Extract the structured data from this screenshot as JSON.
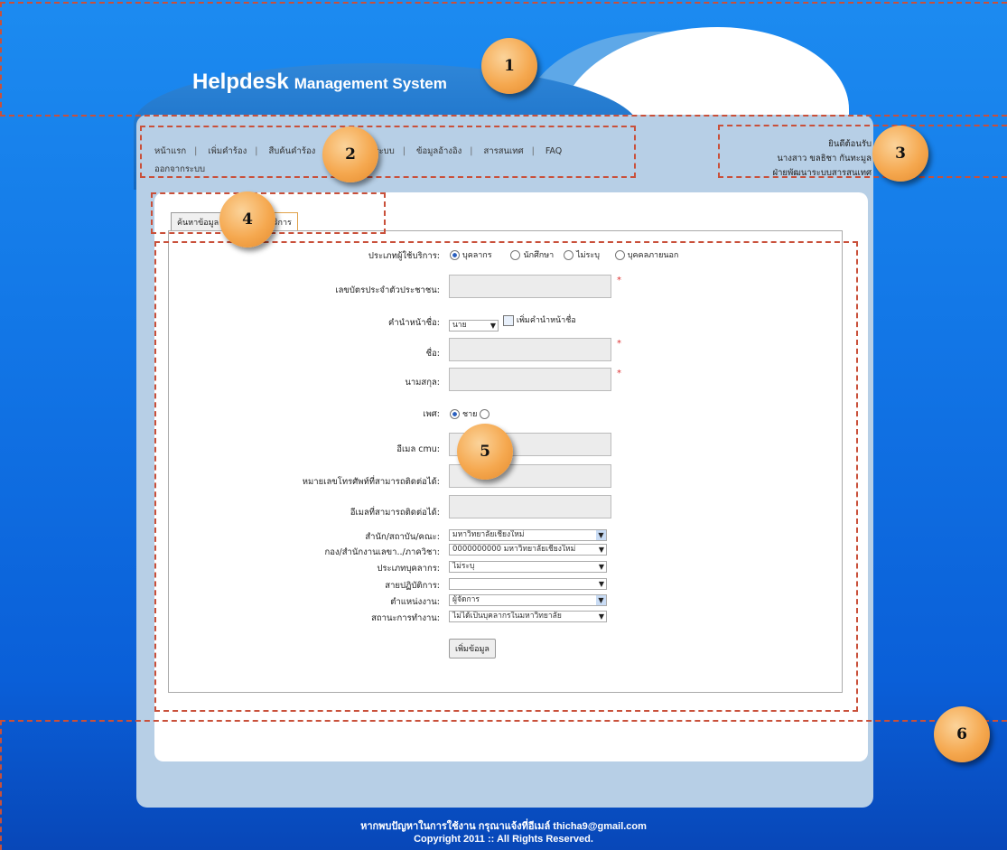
{
  "header": {
    "title_main": "Helpdesk",
    "title_sub": "Management System"
  },
  "nav": {
    "items": [
      "หน้าแรก",
      "เพิ่มคำร้อง",
      "สืบค้นคำร้อง",
      "ข้อมูลผู้ใช้ระบบ",
      "ข้อมูลอ้างอิง",
      "สารสนเทศ",
      "FAQ"
    ],
    "logout": "ออกจากระบบ"
  },
  "welcome": {
    "line1": "ยินดีต้อนรับ",
    "line2": "นางสาว ขลธิชา กันทะมูล",
    "line3": "ฝ่ายพัฒนาระบบสารสนเทศ"
  },
  "tabs": [
    "ค้นหาข้อมูล",
    "ข้อมูลผู้ใช้บริการ"
  ],
  "form": {
    "service_type_label": "ประเภทผู้ใช้บริการ:",
    "service_types": [
      "บุคลากร",
      "นักศึกษา",
      "ไม่ระบุ",
      "บุคคลภายนอก"
    ],
    "id_label": "เลขบัตรประจำตัวประชาชน:",
    "prefix_label": "คำนำหน้าชื่อ:",
    "prefix_value": "นาย",
    "add_prefix": "เพิ่มคำนำหน้าชื่อ",
    "name_label": "ชื่อ:",
    "surname_label": "นามสกุล:",
    "gender_label": "เพศ:",
    "gender_male": "ชาย",
    "email_cmu_label": "อีเมล cmu:",
    "phone_label": "หมายเลขโทรศัพท์ที่สามารถติดต่อได้:",
    "email_label": "อีเมลที่สามารถติดต่อได้:",
    "required_mark": "*",
    "org_label": "สำนัก/สถาบัน/คณะ:",
    "org_value": "มหาวิทยาลัยเชียงใหม่",
    "dept_label": "กอง/สำนักงานเลขา../ภาควิชา:",
    "dept_value": "0000000000 มหาวิทยาลัยเชียงใหม่",
    "staff_type_label": "ประเภทบุคลากร:",
    "staff_type_value": "ไม่ระบุ",
    "line_label": "สายปฏิบัติการ:",
    "line_value": "",
    "position_label": "ตำแหน่งงาน:",
    "position_value": "ผู้จัดการ",
    "status_label": "สถานะการทำงาน:",
    "status_value": "ไม่ได้เป็นบุคลากรในมหาวิทยาลัย",
    "submit": "เพิ่มข้อมูล"
  },
  "footer": {
    "line1": "หากพบปัญหาในการใช้งาน กรุณาแจ้งที่อีเมล์ thicha9@gmail.com",
    "line2": "Copyright 2011 :: All Rights Reserved."
  },
  "markers": [
    "1",
    "2",
    "3",
    "4",
    "5",
    "6"
  ]
}
